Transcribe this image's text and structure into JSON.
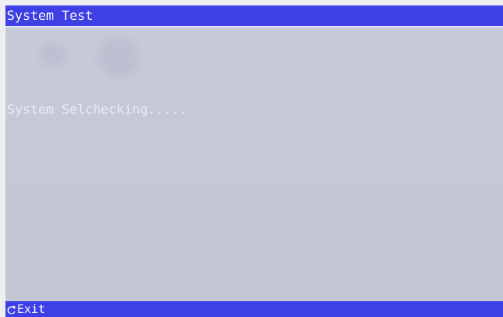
{
  "window": {
    "title": "System Test"
  },
  "main": {
    "status_message": "System Selchecking....."
  },
  "footer": {
    "exit_label": "Exit",
    "exit_icon": "refresh-arrow-icon"
  },
  "colors": {
    "bar_blue": "#3f3fe6",
    "screen_background": "#c5c8d7",
    "text": "#f2f2f8"
  }
}
